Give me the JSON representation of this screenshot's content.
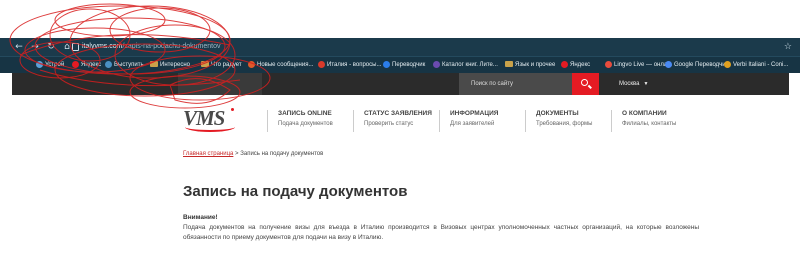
{
  "browser": {
    "url_host": "italyvms.com",
    "url_path": "/zapis-na-podachu-dokumentov",
    "bookmarks": [
      {
        "label": "Устрой",
        "icon": "globe-icon",
        "color": "#5aa0d8"
      },
      {
        "label": "Яндекс",
        "icon": "yandex-icon",
        "color": "#e41b23"
      },
      {
        "label": "Выступить",
        "icon": "globe-icon",
        "color": "#4a90c2"
      },
      {
        "label": "Интересно",
        "icon": "folder-icon",
        "color": "#c9a24a"
      },
      {
        "label": "Что радует",
        "icon": "folder-icon",
        "color": "#c9a24a"
      },
      {
        "label": "Новые сообщения...",
        "icon": "mail-icon",
        "color": "#e05a2a"
      },
      {
        "label": "Италия - вопросы...",
        "icon": "globe-icon",
        "color": "#d93a2b"
      },
      {
        "label": "Переводчик",
        "icon": "translate-icon",
        "color": "#2b7de9"
      },
      {
        "label": "Каталог книг. Лите...",
        "icon": "book-icon",
        "color": "#6b4bb0"
      },
      {
        "label": "Язык и прочее",
        "icon": "folder-icon",
        "color": "#c9a24a"
      },
      {
        "label": "Яндекс",
        "icon": "yandex-icon",
        "color": "#e41b23"
      },
      {
        "label": "Lingvo Live — онла...",
        "icon": "lingvo-icon",
        "color": "#e84c3d"
      },
      {
        "label": "Google Переводчик",
        "icon": "google-translate-icon",
        "color": "#4a8af4"
      },
      {
        "label": "Verbi Italiani - Coni...",
        "icon": "globe-icon",
        "color": "#e0a020"
      }
    ]
  },
  "site": {
    "search_placeholder": "Поиск по сайту",
    "city": "Москва",
    "logo_text": "VMS",
    "menu": [
      {
        "title": "ЗАПИСЬ ONLINE",
        "subtitle": "Подача документов"
      },
      {
        "title": "СТАТУС ЗАЯВЛЕНИЯ",
        "subtitle": "Проверить статус"
      },
      {
        "title": "ИНФОРМАЦИЯ",
        "subtitle": "Для заявителей"
      },
      {
        "title": "ДОКУМЕНТЫ",
        "subtitle": "Требования, формы"
      },
      {
        "title": "О КОМПАНИИ",
        "subtitle": "Филиалы, контакты"
      }
    ],
    "breadcrumb": {
      "home": "Главная страница",
      "separator": ">",
      "current": "Запись на подачу документов"
    },
    "page_title": "Запись на подачу документов",
    "attention": "Внимание!",
    "paragraph": "Подача документов на получение визы для въезда в Италию производится в Визовых центрах уполномоченных частных организаций, на которые возложены обязанности по приему документов для подачи на визу в Италию."
  },
  "colors": {
    "accent": "#e41b23",
    "browser_bar": "#1b3a4b",
    "site_topbar": "#2b2b2b"
  }
}
